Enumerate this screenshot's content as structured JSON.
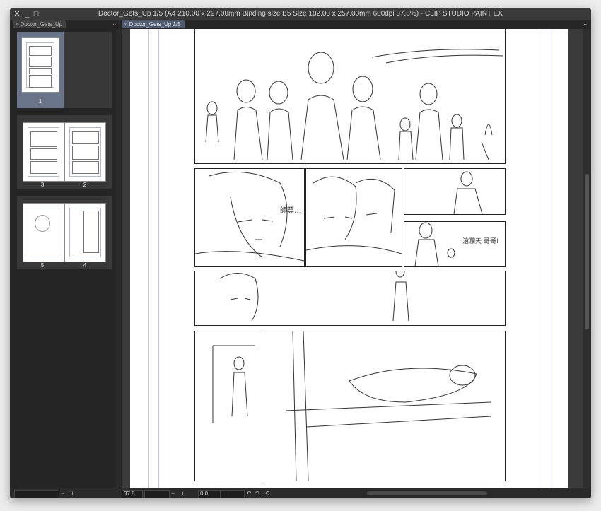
{
  "window": {
    "title": "Doctor_Gets_Up 1/5 (A4 210.00 x 297.00mm Binding size:B5 Size 182.00 x 257.00mm 600dpi 37.8%)  - CLIP STUDIO PAINT EX",
    "controls": {
      "close": "✕",
      "minimize": "_",
      "maximize": "☐"
    }
  },
  "tabs": {
    "page_manager_tab": "Doctor_Gets_Up",
    "canvas_tab": "Doctor_Gets_Up 1/5",
    "close_glyph": "×",
    "collapse_glyph": "⌄"
  },
  "pages": [
    {
      "label": "1",
      "selected": true
    },
    {
      "label": "3",
      "selected": false
    },
    {
      "label": "2",
      "selected": false
    },
    {
      "label": "5",
      "selected": false
    },
    {
      "label": "4",
      "selected": false
    }
  ],
  "statusbar": {
    "zoom_value": "37.8",
    "rotation_value": "0.0",
    "minus": "−",
    "plus": "+"
  },
  "colors": {
    "window_bg": "#2b2b2b",
    "canvas_bg": "#3b3b3b",
    "selected_page_bg": "#6a7488",
    "active_tab_bg": "#4f5b70",
    "guide_line": "#c4c7de"
  },
  "icons": {
    "close": "close-icon",
    "minimize": "minimize-icon",
    "maximize": "maximize-icon",
    "undo": "undo-icon",
    "redo": "redo-icon",
    "reset": "reset-rotation-icon"
  },
  "canvas_sketch": {
    "lettering_panel_a": "師尊…",
    "lettering_panel_b": "滄瀾天 哥哥!"
  }
}
